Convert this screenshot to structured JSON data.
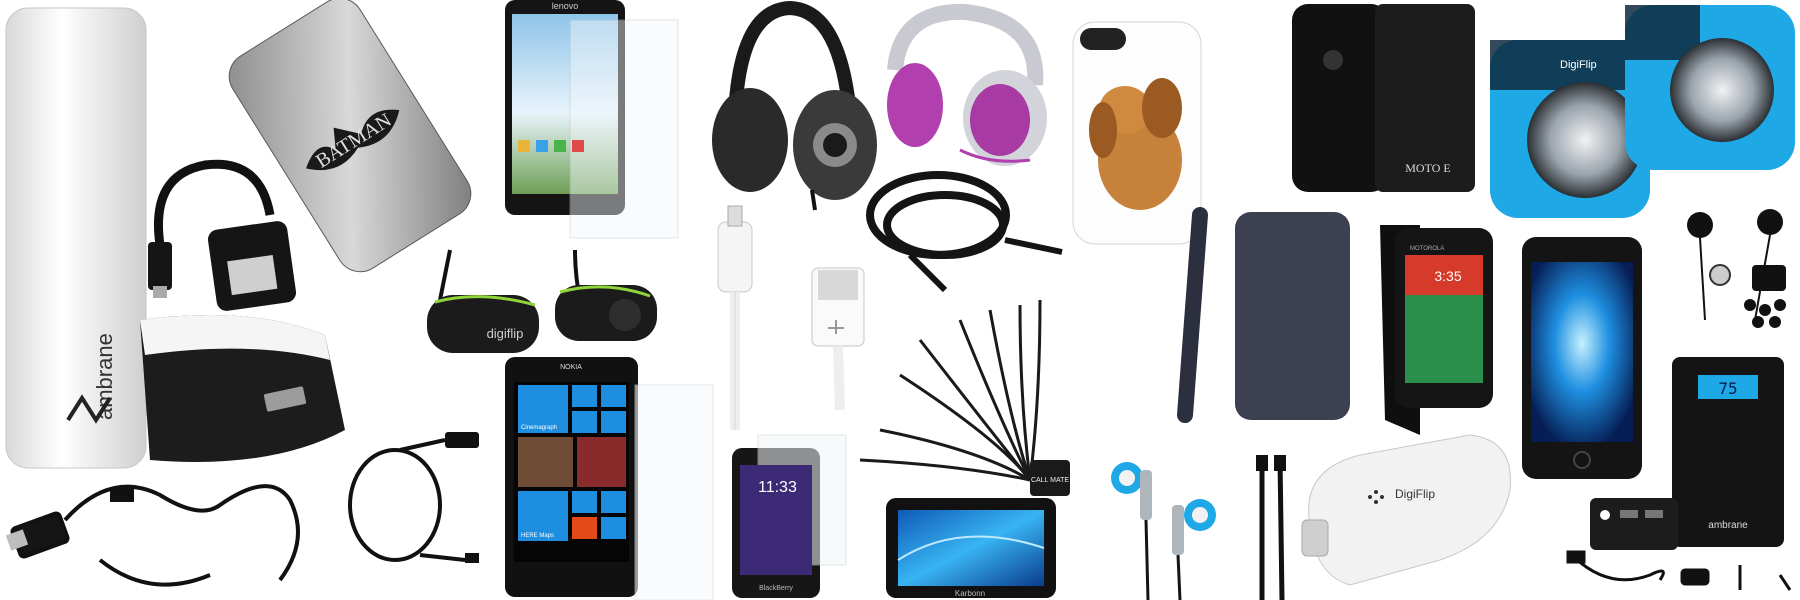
{
  "collage": {
    "items": [
      {
        "name": "power-bank-white",
        "brand_text": "ambrane"
      },
      {
        "name": "otg-usb-adapter"
      },
      {
        "name": "batman-phone-case",
        "print_text": "BATMAN"
      },
      {
        "name": "lenovo-smartphone",
        "brand_text": "lenovo"
      },
      {
        "name": "studio-headphones"
      },
      {
        "name": "purple-headphones"
      },
      {
        "name": "dog-phone-case"
      },
      {
        "name": "moto-e-flip-cover",
        "brand_text": "MOTO E"
      },
      {
        "name": "blue-speakers",
        "brand_text": "DigiFlip"
      },
      {
        "name": "bluetooth-earphones",
        "brand_text": "digiflip"
      },
      {
        "name": "aux-audio-cable"
      },
      {
        "name": "lightning-cable"
      },
      {
        "name": "usb-cable-white"
      },
      {
        "name": "multi-pin-charger-cable",
        "tag_text": "CALL MATE"
      },
      {
        "name": "nokia-lumia-phone",
        "brand_text": "NOKIA",
        "tile_text": "Cinemagraph",
        "tile_text_2": "HERE Maps"
      },
      {
        "name": "blackberry-z10",
        "clock_text": "11:33",
        "brand_text": "BlackBerry"
      },
      {
        "name": "karbonn-tablet",
        "brand_text": "Karbonn"
      },
      {
        "name": "flip-cover-grey"
      },
      {
        "name": "moto-g-flip-phone",
        "brand_text": "MOTOROLA",
        "clock_text": "3:35"
      },
      {
        "name": "android-phone-black"
      },
      {
        "name": "in-ear-earphones-blue"
      },
      {
        "name": "in-ear-earphones-black"
      },
      {
        "name": "car-charger",
        "brand_text": "DigiFlip"
      },
      {
        "name": "power-bank-black",
        "brand_text": "ambrane",
        "display_text": "75"
      },
      {
        "name": "micro-usb-cable-black"
      },
      {
        "name": "usb-cable-black-coiled"
      }
    ]
  },
  "colors": {
    "speaker_blue": "#1ea8e6",
    "headphone_purple": "#b23fae",
    "digiflip_green": "#8ed43a"
  }
}
